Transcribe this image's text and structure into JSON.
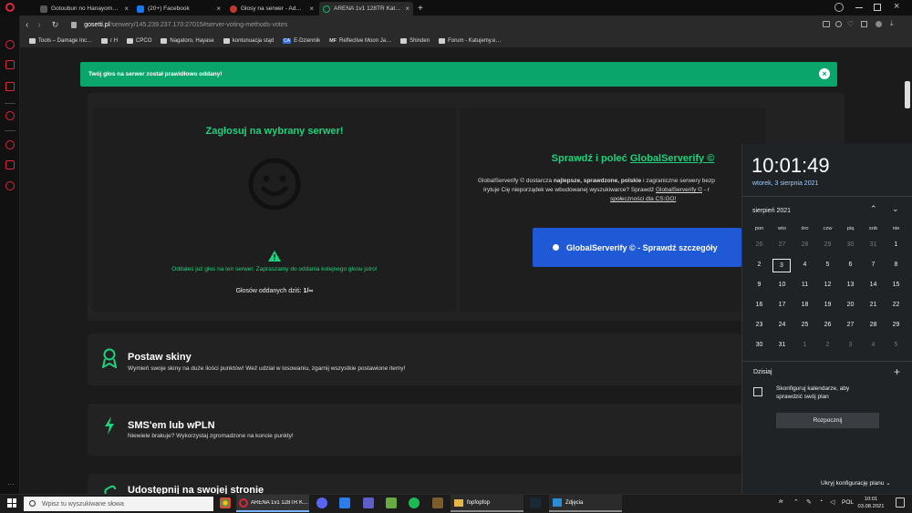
{
  "browser": {
    "tabs": [
      {
        "title": "Gotoubun no Hanayome (z…",
        "icon_color": "#555555",
        "active": false
      },
      {
        "title": "(20+) Facebook",
        "icon_color": "#1877f2",
        "active": false
      },
      {
        "title": "Głosy na serwer - Administ…",
        "icon_color": "#c0392b",
        "active": false
      },
      {
        "title": "ARENA 1v1 128TR Katujemy…",
        "icon_color": "#12b76a",
        "active": true
      }
    ],
    "new_tab": "+",
    "url_host": "gosetti.pl",
    "url_path": "/serwery/145.239.237.170:27015#server-voting-methods-votes",
    "bookmarks": [
      "Tools – Damage Inc…",
      "r H",
      "CPCO",
      "Nagatoro, Hayase",
      "kontunuacja stąd",
      "E-Dziennik",
      "Reflective Moon Ja…",
      "Shinden",
      "Forum - Katujemy.e…"
    ],
    "bookmark_icons": [
      "CA",
      "MF"
    ]
  },
  "alert": {
    "text": "Twój głos na serwer został prawidłowo oddany!"
  },
  "vote_card": {
    "title": "Zagłosuj na wybrany serwer!",
    "warning": "Oddałeś już głos na ten serwer. Zapraszamy do oddania kolejnego głosu jutro!",
    "count_label": "Głosów oddanych dziś:",
    "count_value": "1/∞"
  },
  "serverify": {
    "title_prefix": "Sprawdź i poleć",
    "title_link": "GlobalServerify ©",
    "line1_a": "GlobalServerify © dostarcza",
    "line1_b": "najlepsze, sprawdzone, polskie",
    "line1_c": "i zagraniczne serwery bezp",
    "line2_a": "Irytuje Cię nieporządek we wbudowanej wyszukiwarce? Sprawdź",
    "line2_link": "GlobalServerify ©",
    "line2_b": "- r",
    "line3": "społeczności dla CS:GO!",
    "button": "GlobalServerify © - Sprawdź szczegóły"
  },
  "features": [
    {
      "title": "Postaw skiny",
      "desc": "Wymień swoje skiny na duże ilości punktów! Weź udział w losowaniu, zgarnij wszystkie postawione itemy!"
    },
    {
      "title": "SMS'em lub wPLN",
      "desc": "Niewiele brakuje? Wykorzystaj zgromadzone na koncie punkty!"
    },
    {
      "title": "Udostępnij na swojej stronie",
      "desc": ""
    }
  ],
  "taskbar": {
    "search_placeholder": "Wpisz tu wyszukiwane słowa",
    "apps": [
      {
        "label": "ARENA 1v1 128TR K…"
      },
      {
        "label": "fopfopfop"
      },
      {
        "label": "Zdjęcia"
      }
    ],
    "lang": "POL",
    "time": "10:01",
    "date": "03.08.2021"
  },
  "clock_flyout": {
    "time": "10:01:49",
    "date_long": "wtorek, 3 sierpnia 2021",
    "month": "sierpień 2021",
    "weekdays": [
      "pon",
      "wto",
      "śro",
      "czw",
      "pią",
      "sob",
      "nie"
    ],
    "days": [
      [
        "26",
        "27",
        "28",
        "29",
        "30",
        "31",
        "1"
      ],
      [
        "2",
        "3",
        "4",
        "5",
        "6",
        "7",
        "8"
      ],
      [
        "9",
        "10",
        "11",
        "12",
        "13",
        "14",
        "15"
      ],
      [
        "16",
        "17",
        "18",
        "19",
        "20",
        "21",
        "22"
      ],
      [
        "23",
        "24",
        "25",
        "26",
        "27",
        "28",
        "29"
      ],
      [
        "30",
        "31",
        "1",
        "2",
        "3",
        "4",
        "5"
      ]
    ],
    "today_label": "Dzisiaj",
    "plus": "+",
    "agenda_text_1": "Skonfiguruj kalendarze, aby",
    "agenda_text_2": "sprawdzić swój plan",
    "start_button": "Rozpocznij",
    "hide_agenda": "Ukryj konfigurację planu"
  },
  "colors": {
    "accent_green": "#1fd17d",
    "alert_green": "#0aa56b",
    "button_blue": "#1f59d6",
    "browser_red": "#e0243a"
  }
}
